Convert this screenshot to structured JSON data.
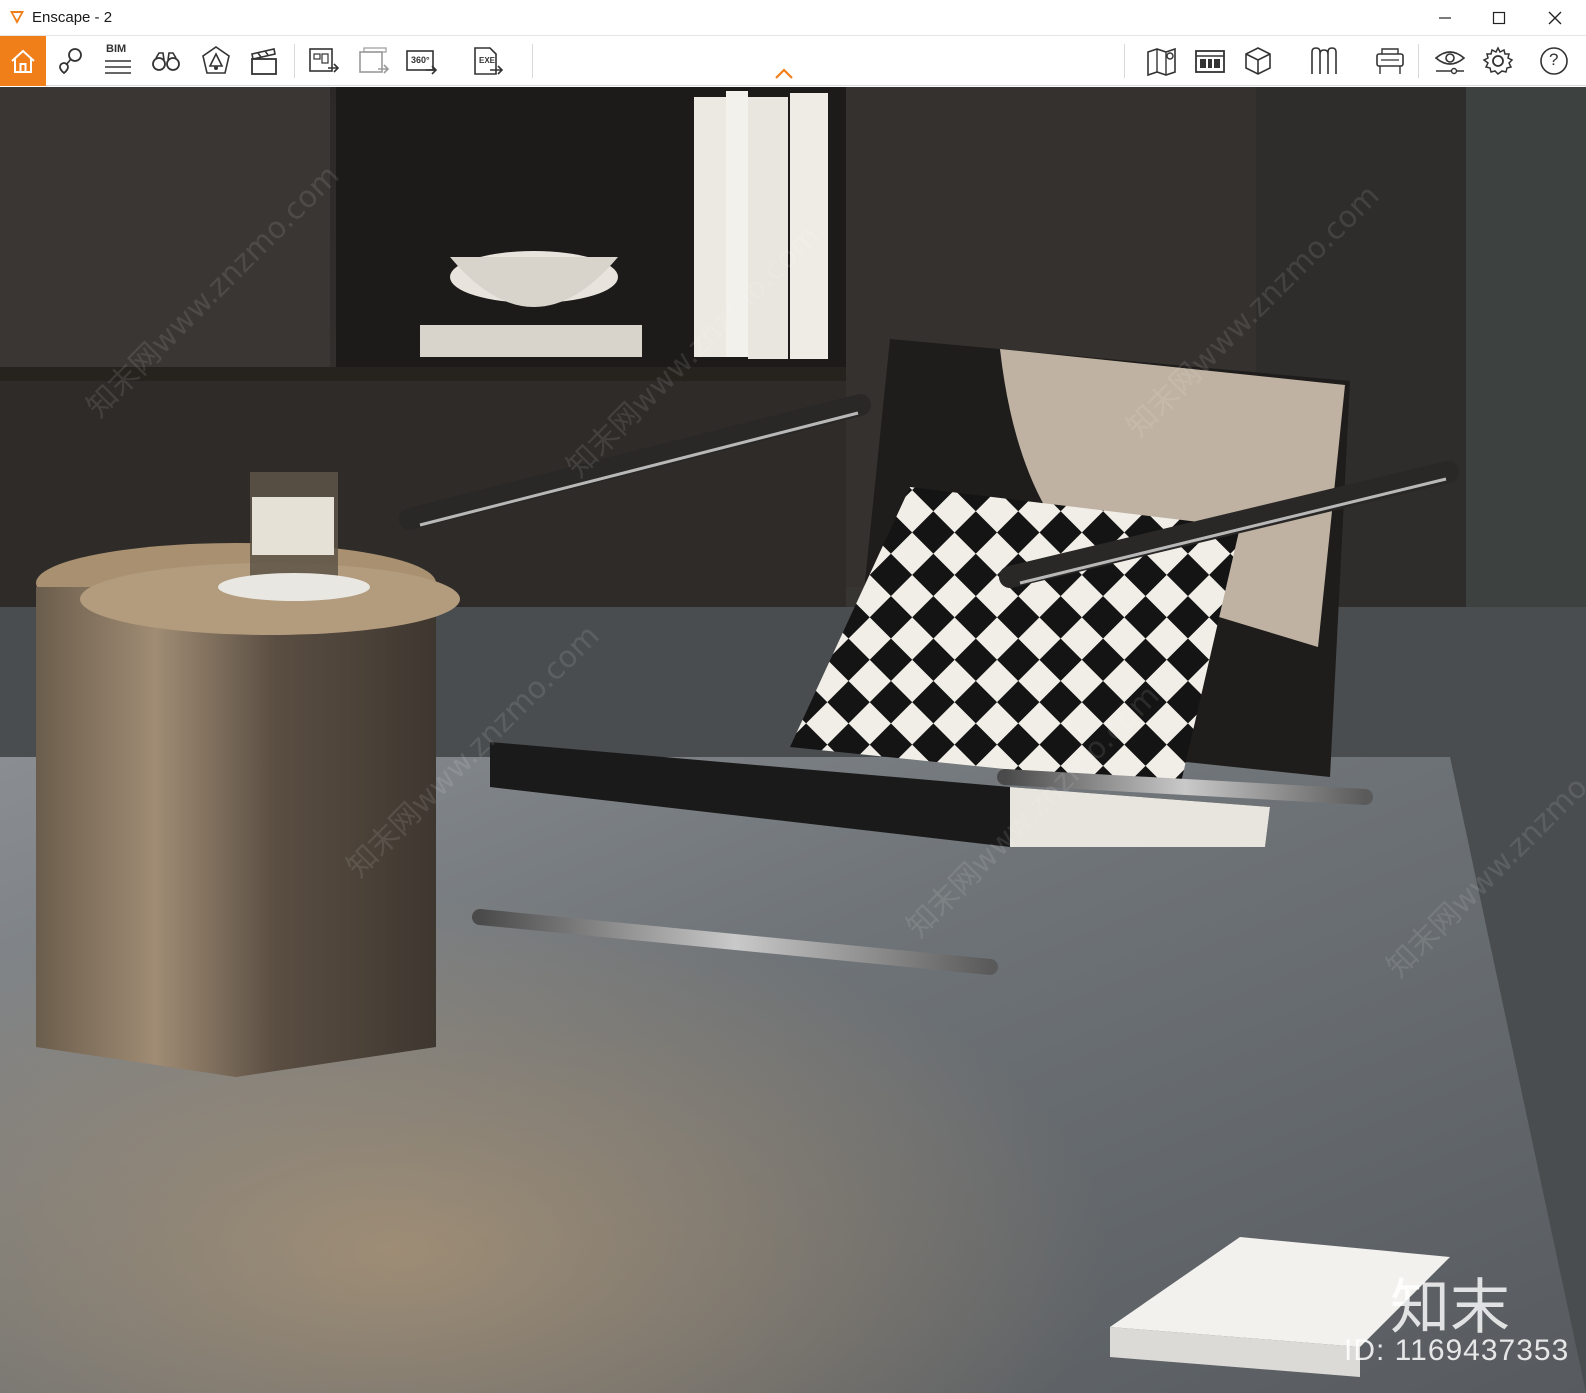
{
  "window": {
    "title": "Enscape - 2",
    "icons": {
      "logo": "enscape-logo-icon",
      "minimize": "minimize-icon",
      "maximize": "maximize-icon",
      "close": "close-icon"
    }
  },
  "toolbar": {
    "accent_color": "#f07f1a",
    "left_tools": [
      {
        "name": "home-icon",
        "label": ""
      },
      {
        "name": "map-pin-icon",
        "label": ""
      },
      {
        "name": "bim-icon",
        "label": "BIM"
      },
      {
        "name": "binoculars-icon",
        "label": ""
      },
      {
        "name": "asset-library-icon",
        "label": ""
      },
      {
        "name": "clapperboard-icon",
        "label": ""
      },
      {
        "name": "render-image-icon",
        "label": ""
      },
      {
        "name": "batch-render-icon",
        "label": ""
      },
      {
        "name": "panorama-360-icon",
        "label": "360°"
      },
      {
        "name": "export-exe-icon",
        "label": "EXE"
      }
    ],
    "right_tools": [
      {
        "name": "map-icon",
        "label": ""
      },
      {
        "name": "views-panel-icon",
        "label": ""
      },
      {
        "name": "cube-icon",
        "label": ""
      },
      {
        "name": "web-standalone-icon",
        "label": ""
      },
      {
        "name": "vr-headset-icon",
        "label": ""
      },
      {
        "name": "visual-settings-icon",
        "label": ""
      },
      {
        "name": "settings-gear-icon",
        "label": ""
      },
      {
        "name": "help-icon",
        "label": "?"
      }
    ],
    "collapse_icon": "chevron-up-icon"
  },
  "viewport": {
    "watermark_logo": "知末",
    "watermark_id": "ID: 1169437353",
    "watermark_diag": "知末网www.znzmo.com"
  }
}
